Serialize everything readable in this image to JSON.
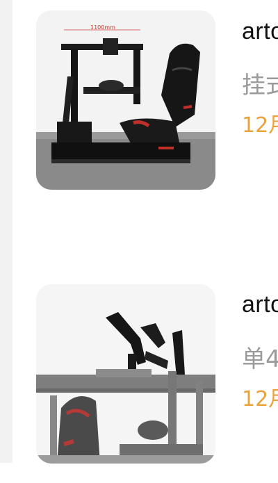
{
  "products": [
    {
      "title": "arto",
      "subtitle": "挂式",
      "date": "12月",
      "image_label": "1100mm"
    },
    {
      "title": "arto",
      "subtitle": "单4",
      "date": "12月"
    }
  ],
  "colors": {
    "date": "#e8a33c",
    "subtitle": "#9a9a9a",
    "title": "#111111",
    "rail": "#f2f2f2"
  }
}
